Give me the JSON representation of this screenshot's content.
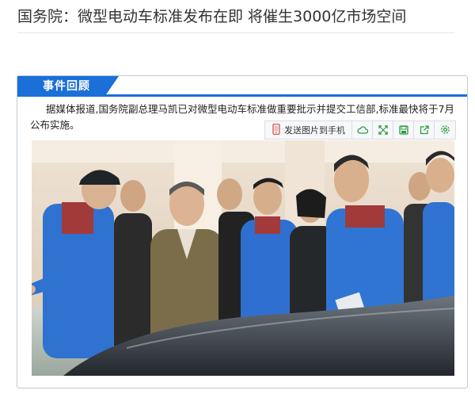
{
  "article": {
    "headline": "国务院：微型电动车标准发布在即  将催生3000亿市场空间"
  },
  "section": {
    "tab_label": "事件回顾",
    "paragraph": "据媒体报道,国务院副总理马凯已对微型电动车标准做重要批示并提交工信部,标准最快将于7月公布实施。"
  },
  "toolbar": {
    "send_to_phone_label": "发送图片到手机",
    "icons": [
      "phone-icon",
      "cloud-icon",
      "fullscreen-icon",
      "save-icon",
      "share-icon",
      "settings-icon"
    ],
    "icon_color": "#2a9d3c"
  },
  "colors": {
    "accent": "#1a6fd8"
  }
}
